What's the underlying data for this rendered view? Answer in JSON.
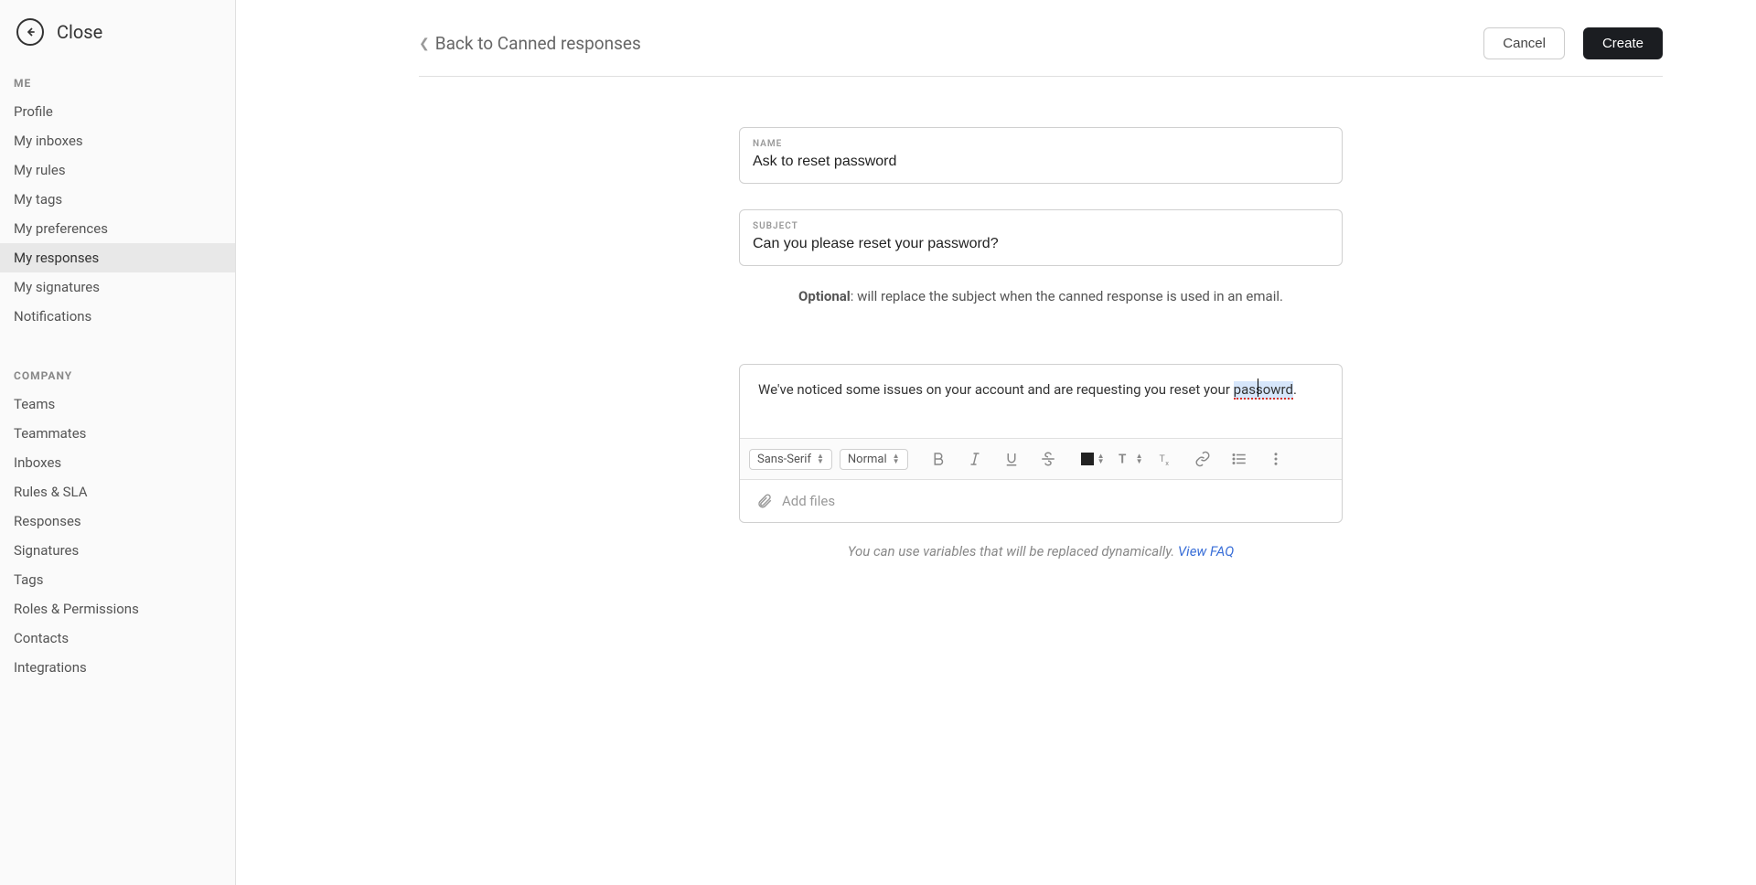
{
  "sidebar": {
    "close_label": "Close",
    "sections": {
      "me": {
        "heading": "ME",
        "items": [
          "Profile",
          "My inboxes",
          "My rules",
          "My tags",
          "My preferences",
          "My responses",
          "My signatures",
          "Notifications"
        ]
      },
      "company": {
        "heading": "COMPANY",
        "items": [
          "Teams",
          "Teammates",
          "Inboxes",
          "Rules & SLA",
          "Responses",
          "Signatures",
          "Tags",
          "Roles & Permissions",
          "Contacts",
          "Integrations"
        ]
      }
    }
  },
  "header": {
    "breadcrumb": "Back to Canned responses",
    "cancel_label": "Cancel",
    "create_label": "Create"
  },
  "form": {
    "name_label": "NAME",
    "name_value": "Ask to reset password",
    "subject_label": "SUBJECT",
    "subject_value": "Can you please reset your password?",
    "subject_helper_bold": "Optional",
    "subject_helper_rest": ": will replace the subject when the canned response is used in an email.",
    "body_text_prefix": "We've noticed some issues on your account and are requesting you reset your ",
    "body_error_word": "passowrd",
    "body_text_suffix": "."
  },
  "toolbar": {
    "font_family": "Sans-Serif",
    "font_size": "Normal",
    "add_files_label": "Add files"
  },
  "footer": {
    "helper_text": "You can use variables that will be replaced dynamically. ",
    "link_text": "View FAQ"
  }
}
